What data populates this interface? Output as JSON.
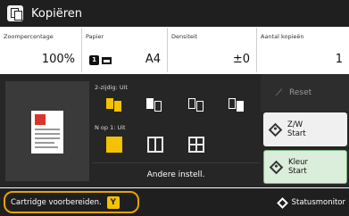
{
  "title_bar": {
    "title": "Kopiëren",
    "icon": "copy-icon"
  },
  "settings": {
    "zoom": {
      "label": "Zoompercentage",
      "value": "100%"
    },
    "paper": {
      "label": "Papier",
      "value": "A4",
      "icons": [
        "paper-source-1-icon",
        "paper-tray-icon"
      ]
    },
    "density": {
      "label": "Densiteit",
      "value": "±0"
    },
    "copies": {
      "label": "Aantal kopieën",
      "value": "1"
    }
  },
  "preview": {
    "icon": "document-preview-icon"
  },
  "duplex": {
    "label": "2-zijdig: Uit",
    "options": [
      "1-1-sided-icon",
      "1-2-sided-icon",
      "2-2-sided-icon",
      "2-1-sided-icon"
    ],
    "selected_index": 0
  },
  "nup": {
    "label": "N op 1: Uit",
    "options": [
      "n-on-1-off-icon",
      "2-on-1-icon",
      "4-on-1-icon"
    ],
    "selected_index": 0
  },
  "other_settings_label": "Andere instell.",
  "reset_label": "Reset",
  "start_bw": {
    "line1": "Z/W",
    "line2": "Start"
  },
  "start_color": {
    "line1": "Kleur",
    "line2": "Start"
  },
  "notice": {
    "text": "Cartridge voorbereiden.",
    "badge": "Y"
  },
  "status_monitor_label": "Statusmonitor",
  "colors": {
    "accent_yellow": "#f4c200",
    "notice_border": "#e3a400",
    "dark_bg": "#262626",
    "color_start_bg": "#dbeddb"
  }
}
